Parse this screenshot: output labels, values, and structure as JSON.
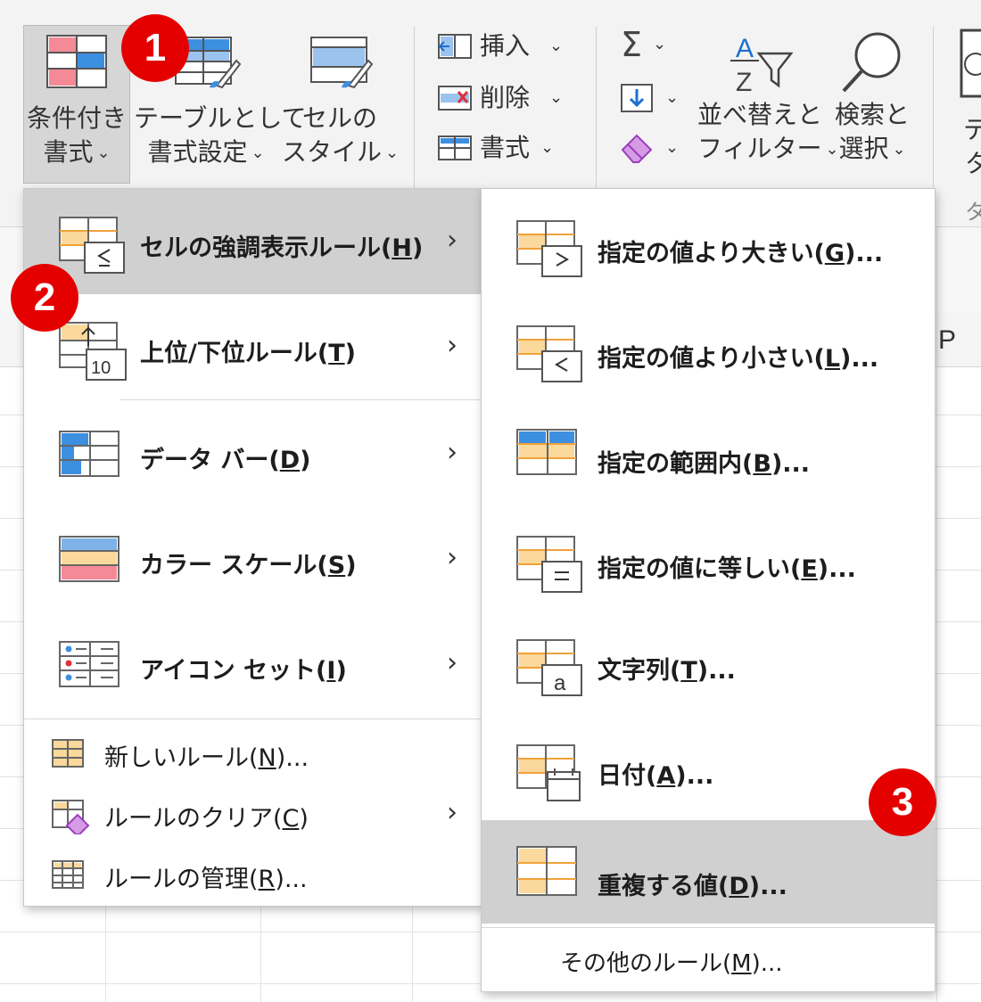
{
  "ribbon": {
    "conditional_format": {
      "line1": "条件付き",
      "line2": "書式"
    },
    "format_as_table": {
      "line1": "テーブルとして",
      "line2": "書式設定"
    },
    "cell_styles": {
      "line1": "セルの",
      "line2": "スタイル"
    },
    "insert": "挿入",
    "delete": "削除",
    "format": "書式",
    "sort_filter": {
      "line1": "並べ替えと",
      "line2": "フィルター"
    },
    "find_select": {
      "line1": "検索と",
      "line2": "選択"
    },
    "cut_off_label": {
      "line1": "テ",
      "line2": "タ",
      "line3": "タ"
    }
  },
  "sheet": {
    "column_p": "P"
  },
  "menu1": {
    "items": [
      {
        "label": "セルの強調表示ルール(",
        "key": "H",
        "suffix": ")"
      },
      {
        "label": "上位/下位ルール(",
        "key": "T",
        "suffix": ")"
      },
      {
        "label": "データ バー(",
        "key": "D",
        "suffix": ")"
      },
      {
        "label": "カラー スケール(",
        "key": "S",
        "suffix": ")"
      },
      {
        "label": "アイコン セット(",
        "key": "I",
        "suffix": ")"
      }
    ],
    "bottom": [
      {
        "label": "新しいルール(",
        "key": "N",
        "suffix": ")..."
      },
      {
        "label": "ルールのクリア(",
        "key": "C",
        "suffix": ")"
      },
      {
        "label": "ルールの管理(",
        "key": "R",
        "suffix": ")..."
      }
    ],
    "top_bottom_icon_text": "10"
  },
  "menu2": {
    "items": [
      {
        "label": "指定の値より大きい(",
        "key": "G",
        "suffix": ")..."
      },
      {
        "label": "指定の値より小さい(",
        "key": "L",
        "suffix": ")..."
      },
      {
        "label": "指定の範囲内(",
        "key": "B",
        "suffix": ")..."
      },
      {
        "label": "指定の値に等しい(",
        "key": "E",
        "suffix": ")..."
      },
      {
        "label": "文字列(",
        "key": "T",
        "suffix": ")..."
      },
      {
        "label": "日付(",
        "key": "A",
        "suffix": ")..."
      },
      {
        "label": "重複する値(",
        "key": "D",
        "suffix": ")..."
      }
    ],
    "more_rules": {
      "label": "その他のルール(",
      "key": "M",
      "suffix": ")..."
    }
  },
  "badges": [
    "1",
    "2",
    "3"
  ],
  "colors": {
    "badge": "#e50000",
    "highlight": "#d0d0d0",
    "orange_fill": "#fbd89b",
    "orange_line": "#f0a23a",
    "blue": "#3d8fe0",
    "red_fill": "#f48a96"
  }
}
